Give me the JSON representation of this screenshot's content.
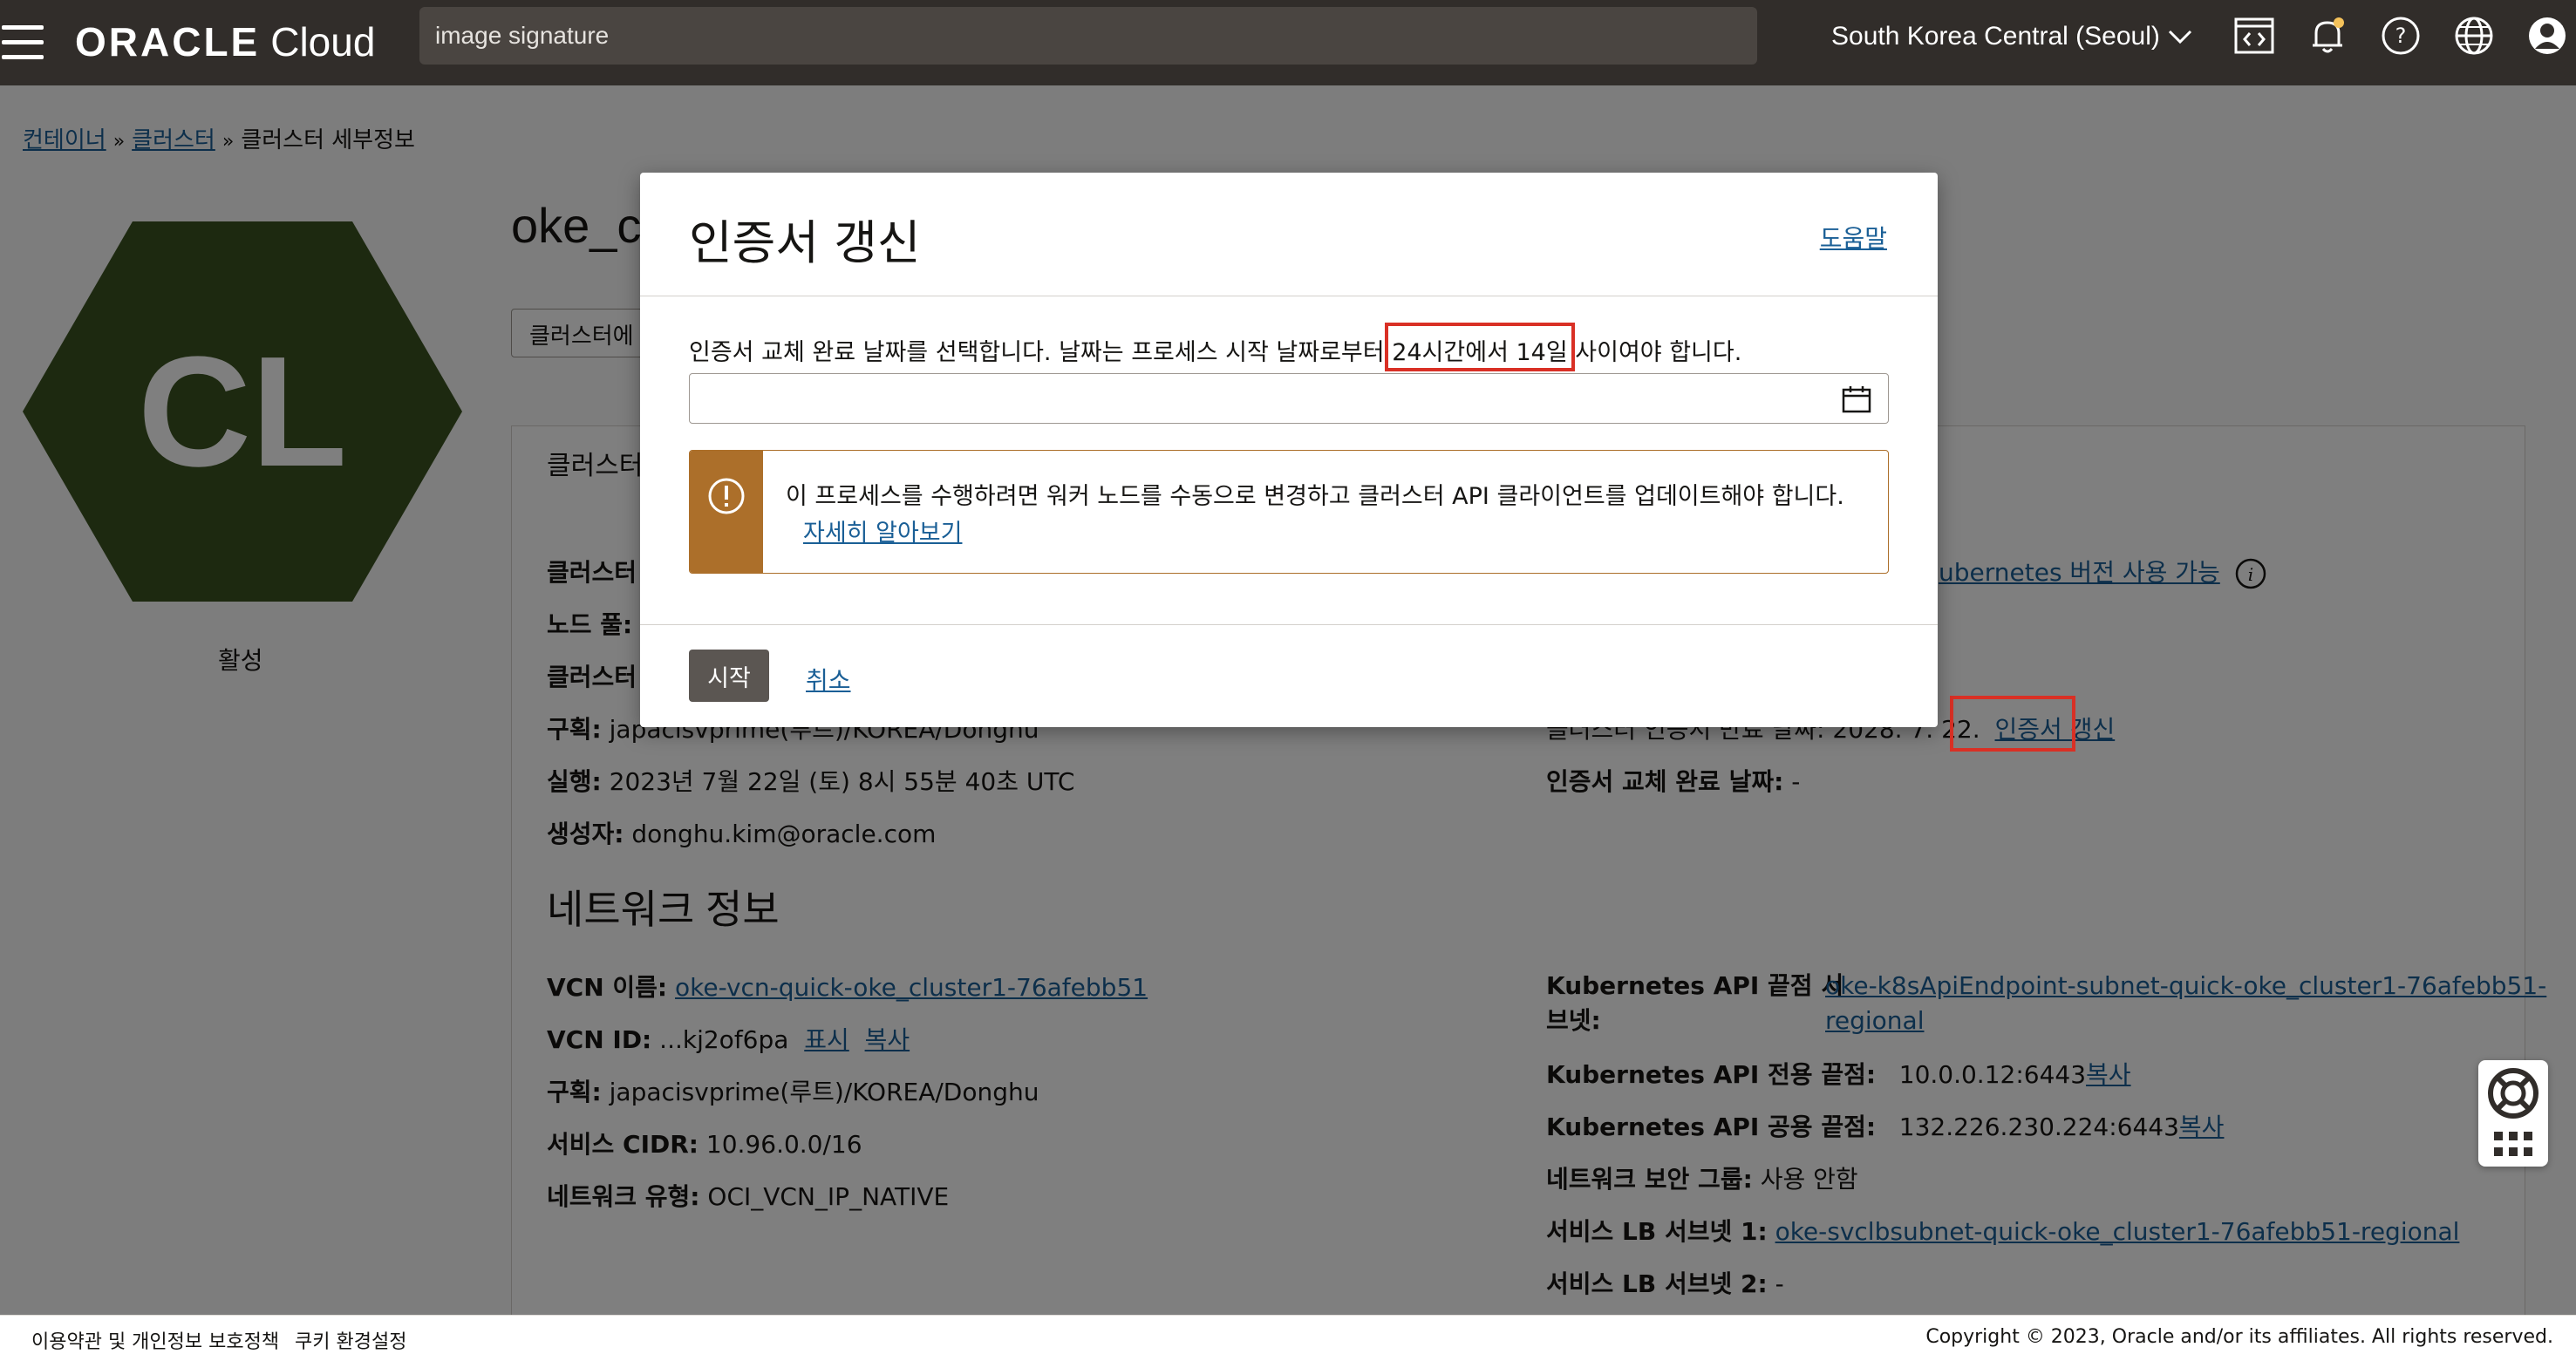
{
  "header": {
    "logo_brand": "ORACLE",
    "logo_product": "Cloud",
    "search_value": "image signature",
    "region": "South Korea Central (Seoul)",
    "icons": [
      "menu-icon",
      "code-editor-icon",
      "bell-icon",
      "help-icon",
      "globe-icon",
      "user-icon"
    ]
  },
  "breadcrumb": [
    "컨테이너",
    "클러스터",
    "클러스터 세부정보"
  ],
  "cluster": {
    "hex_initials": "CL",
    "hex_color": "#3a5320",
    "status": "활성",
    "name": "oke_c",
    "action_button": "클러스터에",
    "panel_tab": "클러스터"
  },
  "info_left": {
    "r1": "클러스터",
    "r2": "노드 풀:",
    "r3": "클러스터",
    "compartment_label": "구획:",
    "compartment_value": "japacisvprime(루트)/KOREA/Donghu",
    "run_label": "실행:",
    "run_value": "2023년 7월 22일 (토) 8시 55분 40초 UTC",
    "creator_label": "생성자:",
    "creator_value": "donghu.kim@oracle.com"
  },
  "info_right": {
    "k8s_link": "ubernetes 버전 사용 가능",
    "cert_expiry_partial": "클러스터 인증서 만료 날짜: 2028. 7. 22.",
    "renew_link": "인증서 갱신",
    "rotation_label": "인증서 교체 완료 날짜:",
    "rotation_value": "-"
  },
  "network": {
    "title": "네트워크 정보",
    "vcn_name_label": "VCN 이름:",
    "vcn_name_value": "oke-vcn-quick-oke_cluster1-76afebb51",
    "vcn_id_label": "VCN ID:",
    "vcn_id_value": "...kj2of6pa",
    "show": "표시",
    "copy": "복사",
    "compartment_label": "구획:",
    "compartment_value": "japacisvprime(루트)/KOREA/Donghu",
    "cidr_label": "서비스 CIDR:",
    "cidr_value": "10.96.0.0/16",
    "type_label": "네트워크 유형:",
    "type_value": "OCI_VCN_IP_NATIVE",
    "api_subnet_label_1": "Kubernetes API 끝점 서",
    "api_subnet_label_2": "브넷:",
    "api_subnet_value_1": "oke-k8sApiEndpoint-subnet-quick-oke_cluster1-76afebb51-",
    "api_subnet_value_2": "regional",
    "private_ep_label": "Kubernetes API 전용 끝점:",
    "private_ep_value": "10.0.0.12:6443",
    "public_ep_label": "Kubernetes API 공용 끝점:",
    "public_ep_value": "132.226.230.224:6443",
    "nsg_label": "네트워크 보안 그룹:",
    "nsg_value": "사용 안함",
    "lb1_label": "서비스 LB 서브넷 1:",
    "lb1_value": "oke-svclbsubnet-quick-oke_cluster1-76afebb51-regional",
    "lb2_label": "서비스 LB 서브넷 2:",
    "lb2_value": "-"
  },
  "footer": {
    "terms": "이용약관 및 개인정보 보호정책",
    "cookies": "쿠키 환경설정",
    "copyright": "Copyright © 2023, Oracle and/or its affiliates. All rights reserved."
  },
  "dialog": {
    "title": "인증서 갱신",
    "help": "도움말",
    "desc_before": "인증서 교체 완료 날짜를 선택합니다. 날짜는 프로세스 시작 날짜로부터 ",
    "desc_highlight": "24시간에서 14일",
    "desc_after": " 사이여야 합니다.",
    "date_value": "",
    "warning_text": "이 프로세스를 수행하려면 워커 노드를 수동으로 변경하고 클러스터 API 클라이언트를 업데이트해야 합니다.",
    "warning_link": "자세히 알아보기",
    "start_button": "시작",
    "cancel_link": "취소",
    "warning_color": "#ac6f2a",
    "annotation_color": "#d93025"
  }
}
